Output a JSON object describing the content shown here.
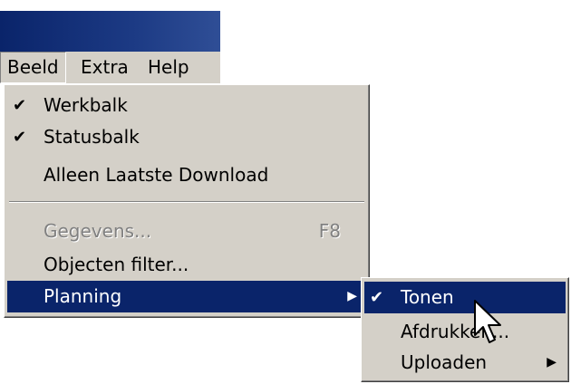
{
  "menubar": {
    "items": [
      {
        "label": "Beeld",
        "active": true
      },
      {
        "label": "Extra",
        "active": false
      },
      {
        "label": "Help",
        "active": false
      }
    ]
  },
  "beeld_menu": {
    "items": [
      {
        "label": "Werkbalk",
        "checked": true
      },
      {
        "label": "Statusbalk",
        "checked": true
      },
      {
        "label": "Alleen Laatste Download",
        "checked": false
      },
      {
        "label": "Gegevens...",
        "shortcut": "F8",
        "disabled": true
      },
      {
        "label": "Objecten filter...",
        "checked": false
      },
      {
        "label": "Planning",
        "submenu": true,
        "selected": true
      }
    ]
  },
  "planning_submenu": {
    "items": [
      {
        "label": "Tonen",
        "checked": true,
        "selected": true
      },
      {
        "label": "Afdrukken...",
        "checked": false
      },
      {
        "label": "Uploaden",
        "submenu": true
      }
    ]
  },
  "glyphs": {
    "check": "✔",
    "arrow": "▶"
  },
  "colors": {
    "menu_bg": "#d4d0c8",
    "highlight": "#0a246a",
    "disabled": "#808080"
  }
}
